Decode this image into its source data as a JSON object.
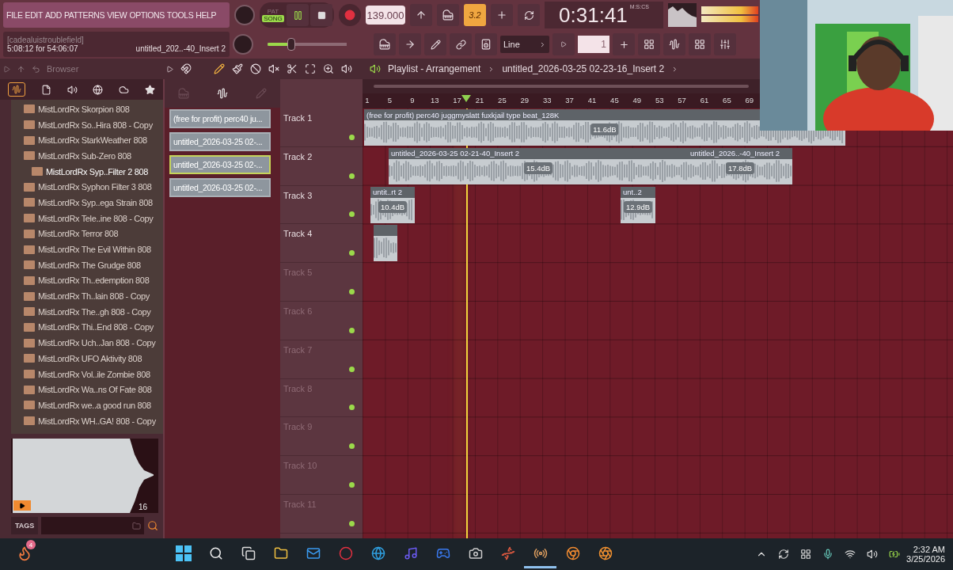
{
  "menu": [
    "FILE",
    "EDIT",
    "ADD",
    "PATTERNS",
    "VIEW",
    "OPTIONS",
    "TOOLS",
    "HELP"
  ],
  "hint": {
    "title": "[cadealuistroublefield]",
    "detail": "5:08:12 for 54:06:07",
    "target": "untitled_202..-40_Insert 2"
  },
  "mode": [
    {
      "label": "PAT",
      "selected": false
    },
    {
      "label": "SONG",
      "selected": true
    }
  ],
  "tempo": "139.000",
  "snap_button": {
    "label": "3.2",
    "on": true
  },
  "time": {
    "value": "0:31:41",
    "unit": "M:S:CS"
  },
  "master_volume": {
    "level": 0.3
  },
  "snap": "Line",
  "pattern": "1",
  "browser": {
    "title": "Browser",
    "items": [
      {
        "label": "MistLordRx Skorpion 808",
        "selected": false
      },
      {
        "label": "MistLordRx So..Hira 808 - Copy",
        "selected": false
      },
      {
        "label": "MistLordRx StarkWeather 808",
        "selected": false
      },
      {
        "label": "MistLordRx Sub-Zero 808",
        "selected": false
      },
      {
        "label": "MistLordRx Syp..Filter 2 808",
        "selected": true
      },
      {
        "label": "MistLordRx Syphon Filter 3 808",
        "selected": false
      },
      {
        "label": "MistLordRx Syp..ega Strain 808",
        "selected": false
      },
      {
        "label": "MistLordRx Tele..ine 808 - Copy",
        "selected": false
      },
      {
        "label": "MistLordRx Terror 808",
        "selected": false
      },
      {
        "label": "MistLordRx The Evil Within 808",
        "selected": false
      },
      {
        "label": "MistLordRx The Grudge 808",
        "selected": false
      },
      {
        "label": "MistLordRx Th..edemption 808",
        "selected": false
      },
      {
        "label": "MistLordRx Th..lain 808 - Copy",
        "selected": false
      },
      {
        "label": "MistLordRx The..gh 808 - Copy",
        "selected": false
      },
      {
        "label": "MistLordRx Thi..End 808 - Copy",
        "selected": false
      },
      {
        "label": "MistLordRx Uch..Jan 808 - Copy",
        "selected": false
      },
      {
        "label": "MistLordRx UFO Aktivity 808",
        "selected": false
      },
      {
        "label": "MistLordRx Vol..ile Zombie 808",
        "selected": false
      },
      {
        "label": "MistLordRx Wa..ns Of Fate 808",
        "selected": false
      },
      {
        "label": "MistLordRx we..a good run 808",
        "selected": false
      },
      {
        "label": "MistLordRx WH..GA! 808 - Copy",
        "selected": false
      }
    ],
    "preview_length": "16",
    "tags_label": "TAGS"
  },
  "picker": {
    "items": [
      {
        "label": "(free for profit) perc40 ju...",
        "selected": false
      },
      {
        "label": "untitled_2026-03-25 02-...",
        "selected": false
      },
      {
        "label": "untitled_2026-03-25 02-...",
        "selected": true
      },
      {
        "label": "untitled_2026-03-25 02-...",
        "selected": false
      }
    ]
  },
  "playlist": {
    "title": "Playlist - Arrangement",
    "pattern": "untitled_2026-03-25 02-23-16_Insert 2",
    "ruler": [
      "1",
      "5",
      "9",
      "13",
      "17",
      "21",
      "25",
      "29",
      "33",
      "37",
      "41",
      "45",
      "49",
      "53",
      "57",
      "61",
      "65",
      "69"
    ],
    "tracks": [
      {
        "name": "Track 1",
        "clips": [
          {
            "kind": "audio",
            "title": "(free for profit) perc40 juggmyslatt fuxkjail type beat_128K",
            "gain": "11.6dB"
          }
        ]
      },
      {
        "name": "Track 2",
        "clips": [
          {
            "kind": "audio",
            "title": "untitled_2026-03-25 02-21-40_Insert 2",
            "gain": "15.4dB"
          },
          {
            "kind": "audio",
            "title": "untitled_2026..-40_Insert 2",
            "gain": "17.8dB"
          }
        ]
      },
      {
        "name": "Track 3",
        "clips": [
          {
            "kind": "audio",
            "title": "untit..rt 2",
            "gain": "10.4dB"
          },
          {
            "kind": "audio",
            "title": "unt..2",
            "gain": "12.9dB"
          }
        ]
      },
      {
        "name": "Track 4",
        "clips": [
          {
            "kind": "audio"
          }
        ]
      },
      {
        "name": "Track 5"
      },
      {
        "name": "Track 6"
      },
      {
        "name": "Track 7"
      },
      {
        "name": "Track 8"
      },
      {
        "name": "Track 9"
      },
      {
        "name": "Track 10"
      },
      {
        "name": "Track 11"
      }
    ]
  },
  "taskbar": {
    "badge": "4",
    "time": "2:32 AM",
    "date": "3/25/2026",
    "apps": [
      {
        "selected": false
      },
      {
        "selected": false
      },
      {
        "selected": false
      },
      {
        "selected": false
      },
      {
        "selected": false
      },
      {
        "selected": false
      },
      {
        "selected": false
      },
      {
        "selected": false
      },
      {
        "selected": false
      },
      {
        "selected": false
      },
      {
        "selected": false
      },
      {
        "selected": false
      },
      {
        "selected": true
      },
      {
        "selected": false
      },
      {
        "selected": false
      }
    ]
  }
}
